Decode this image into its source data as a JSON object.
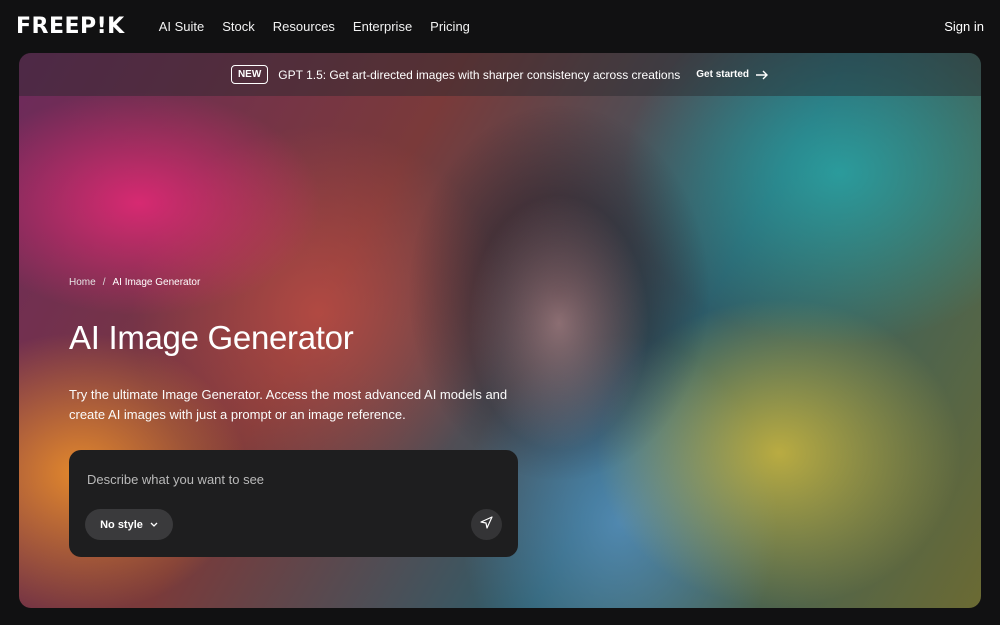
{
  "header": {
    "logo": "FREEP!K",
    "nav": [
      "AI Suite",
      "Stock",
      "Resources",
      "Enterprise",
      "Pricing"
    ],
    "sign_in": "Sign in"
  },
  "banner": {
    "badge": "NEW",
    "text": "GPT 1.5: Get art-directed images with sharper consistency across creations",
    "cta": "Get started",
    "cta_icon": "arrow-right-icon"
  },
  "breadcrumb": {
    "home": "Home",
    "separator": "/",
    "current": "AI Image Generator"
  },
  "hero": {
    "title": "AI Image Generator",
    "description": "Try the ultimate Image Generator. Access the most advanced AI models and create AI images with just a prompt or an image reference."
  },
  "prompt": {
    "placeholder": "Describe what you want to see",
    "style_label": "No style",
    "send_icon": "send-icon"
  }
}
